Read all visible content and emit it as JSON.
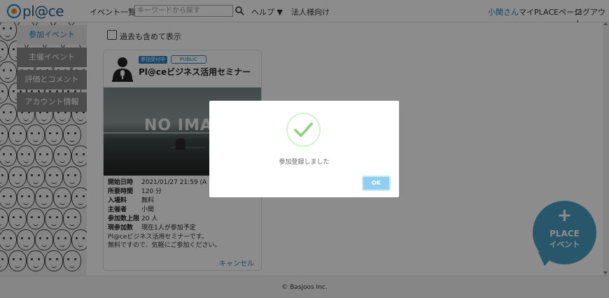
{
  "header": {
    "logo_text": "pl@ce",
    "nav_events": "イベント一覧",
    "search_placeholder": "キーワードから探す",
    "help": "ヘルプ ▼",
    "corporate": "法人様向け",
    "user_name": "小関さん",
    "mypage": "マイPLACEページ",
    "logout": "ログアウト"
  },
  "sidebar": {
    "items": [
      {
        "label": "参加イベント",
        "active": true
      },
      {
        "label": "主催イベント",
        "active": false
      },
      {
        "label": "評価とコメント",
        "active": false
      },
      {
        "label": "アカウント情報",
        "active": false
      }
    ]
  },
  "filters": {
    "include_past_label": "過去も含めて表示",
    "include_past_checked": false
  },
  "event_card": {
    "status_badge": "参加受付中",
    "visibility_badge": "PUBLIC",
    "title": "Pl@ceビジネス活用セミナー",
    "image_text": "NO IMAGE",
    "details": [
      {
        "key": "開始日時",
        "value": "2021/01/27 21:59 (A"
      },
      {
        "key": "所要時間",
        "value": "120 分"
      },
      {
        "key": "入場料",
        "value": "無料"
      },
      {
        "key": "主催者",
        "value": "小関"
      },
      {
        "key": "参加数上限",
        "value": "20 人"
      },
      {
        "key": "現参加数",
        "value": "現在1人が参加予定"
      }
    ],
    "description_line1": "Pl@ceビジネス活用セミナーです。",
    "description_line2": "無料ですので、気軽にご参加ください。",
    "cancel_label": "キャンセル"
  },
  "modal": {
    "message": "参加登録しました",
    "ok_label": "OK",
    "accent_color": "#8fd0f1",
    "check_color": "#8bcf7e"
  },
  "fab": {
    "plus": "+",
    "line1": "PLACE",
    "line2": "イベント",
    "color": "#4a9fc4"
  },
  "footer": {
    "copyright": "© Basjoos Inc."
  }
}
